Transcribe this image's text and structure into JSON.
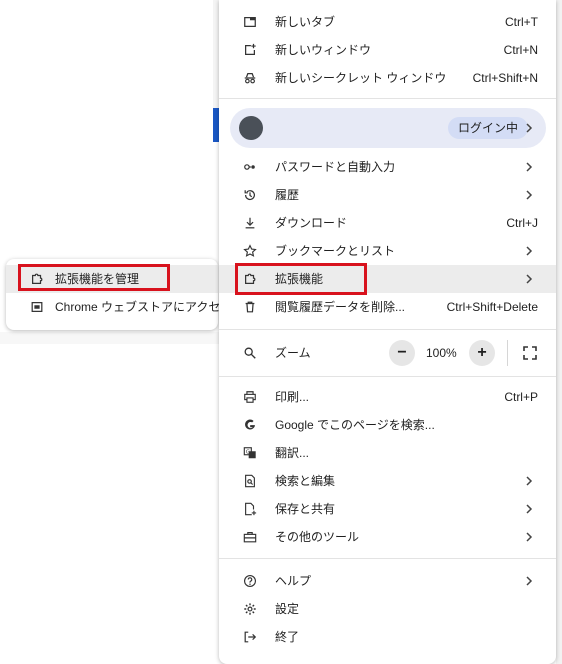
{
  "colors": {
    "highlight": "#d8121d",
    "profile_bg": "#e7eaf6",
    "login_chip_bg": "#d3dcf5",
    "active_row_bg": "#ececec"
  },
  "menu": {
    "new_tab": {
      "label": "新しいタブ",
      "shortcut": "Ctrl+T",
      "icon": "new-tab-icon"
    },
    "new_window": {
      "label": "新しいウィンドウ",
      "shortcut": "Ctrl+N",
      "icon": "new-window-icon"
    },
    "incognito": {
      "label": "新しいシークレット ウィンドウ",
      "shortcut": "Ctrl+Shift+N",
      "icon": "incognito-icon"
    },
    "profile": {
      "login_label": "ログイン中",
      "icon": "avatar"
    },
    "passwords": {
      "label": "パスワードと自動入力",
      "icon": "key-icon"
    },
    "history": {
      "label": "履歴",
      "icon": "history-icon"
    },
    "downloads": {
      "label": "ダウンロード",
      "shortcut": "Ctrl+J",
      "icon": "download-icon"
    },
    "bookmarks": {
      "label": "ブックマークとリスト",
      "icon": "star-icon"
    },
    "extensions": {
      "label": "拡張機能",
      "icon": "puzzle-icon"
    },
    "clear_data": {
      "label": "閲覧履歴データを削除...",
      "shortcut": "Ctrl+Shift+Delete",
      "icon": "trash-icon"
    },
    "zoom": {
      "label": "ズーム",
      "value": "100%",
      "minus": "−",
      "plus": "+",
      "icon": "zoom-icon"
    },
    "print": {
      "label": "印刷...",
      "shortcut": "Ctrl+P",
      "icon": "print-icon"
    },
    "google_search": {
      "label": "Google でこのページを検索...",
      "icon": "google-icon"
    },
    "translate": {
      "label": "翻訳...",
      "icon": "translate-icon"
    },
    "find_edit": {
      "label": "検索と編集",
      "icon": "find-icon"
    },
    "save_share": {
      "label": "保存と共有",
      "icon": "save-share-icon"
    },
    "more_tools": {
      "label": "その他のツール",
      "icon": "toolbox-icon"
    },
    "help": {
      "label": "ヘルプ",
      "icon": "help-icon"
    },
    "settings": {
      "label": "設定",
      "icon": "gear-icon"
    },
    "exit": {
      "label": "終了",
      "icon": "exit-icon"
    }
  },
  "submenu": {
    "manage_extensions": {
      "label": "拡張機能を管理",
      "icon": "puzzle-icon"
    },
    "web_store": {
      "label": "Chrome ウェブストアにアクセス",
      "icon": "webstore-icon"
    }
  }
}
